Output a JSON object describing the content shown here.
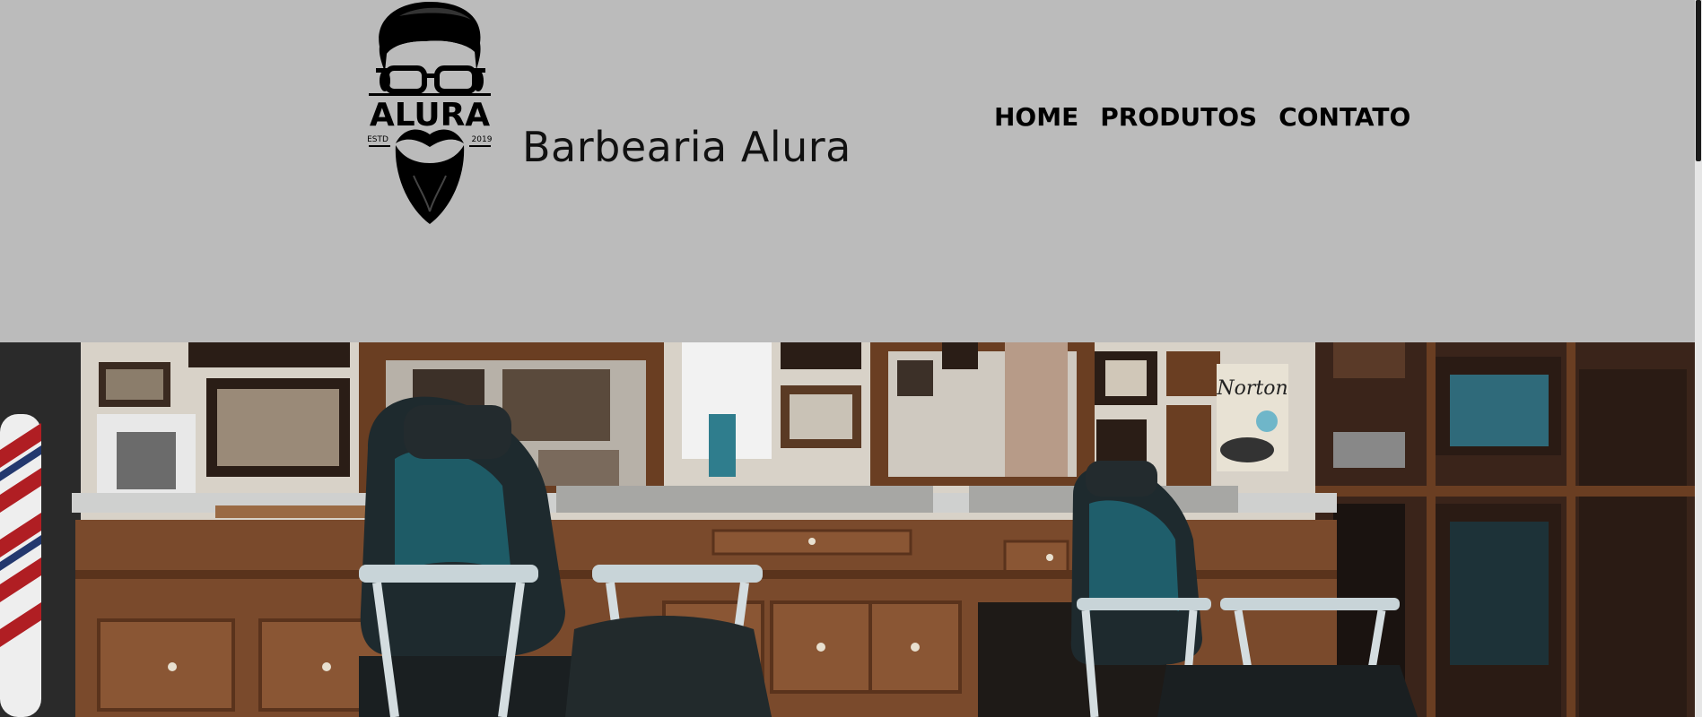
{
  "header": {
    "logo": {
      "icon": "bearded-man-with-glasses-logo",
      "text": "ALURA",
      "est_left": "ESTD",
      "est_right": "2019"
    },
    "title": "Barbearia Alura"
  },
  "nav": {
    "items": [
      {
        "label": "HOME"
      },
      {
        "label": "PRODUTOS"
      },
      {
        "label": "CONTATO"
      }
    ]
  },
  "banner": {
    "description_icon": "barbershop-interior-photo",
    "sign_text": "Norton"
  },
  "colors": {
    "header_bg": "#bbbbbb",
    "text": "#000000",
    "wood": "#7a4a2c",
    "chair_leather": "#1e2a2e",
    "chair_teal": "#1f6c7a"
  }
}
